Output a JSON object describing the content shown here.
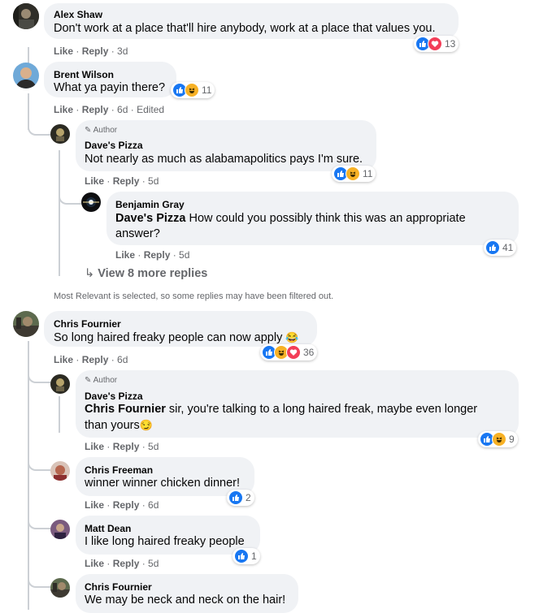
{
  "comments": [
    {
      "name": "Alex Shaw",
      "text": "Don't work at a place that'll hire anybody, work at a place that values you.",
      "reaction_count": "13",
      "like": "Like",
      "reply": "Reply",
      "time": "3d"
    },
    {
      "name": "Brent Wilson",
      "text": "What ya payin there?",
      "reaction_count": "11",
      "like": "Like",
      "reply": "Reply",
      "time": "6d",
      "edited": "Edited"
    },
    {
      "author_badge": "Author",
      "name": "Dave's Pizza",
      "text": "Not nearly as much as alabamapolitics pays I'm sure.",
      "reaction_count": "11",
      "like": "Like",
      "reply": "Reply",
      "time": "5d"
    },
    {
      "name": "Benjamin Gray",
      "mention": "Dave's Pizza",
      "text": " How could you possibly think this was an appropriate answer?",
      "reaction_count": "41",
      "like": "Like",
      "reply": "Reply",
      "time": "5d"
    },
    {
      "name": "Chris Fournier",
      "text": "So long haired freaky people can now apply",
      "emoji": "😂",
      "reaction_count": "36",
      "like": "Like",
      "reply": "Reply",
      "time": "6d"
    },
    {
      "author_badge": "Author",
      "name": "Dave's Pizza",
      "mention": "Chris Fournier",
      "text": " sir, you're talking to a long haired freak, maybe even longer than yours",
      "emoji": "😏",
      "reaction_count": "9",
      "like": "Like",
      "reply": "Reply",
      "time": "5d"
    },
    {
      "name": "Chris Freeman",
      "text": "winner winner chicken dinner!",
      "reaction_count": "2",
      "like": "Like",
      "reply": "Reply",
      "time": "6d"
    },
    {
      "name": "Matt Dean",
      "text": "I like long haired freaky people",
      "reaction_count": "1",
      "like": "Like",
      "reply": "Reply",
      "time": "5d"
    },
    {
      "name": "Chris Fournier",
      "text": "We may be neck and neck on the hair!"
    }
  ],
  "view_more": "View 8 more replies",
  "filter_notice": "Most Relevant is selected, so some replies may have been filtered out.",
  "colors": {
    "like": "#1877f2",
    "love": "#f33e58",
    "haha": "#f7b125",
    "bubble": "#f0f2f5",
    "meta": "#65676b"
  },
  "icons": {
    "like": "thumbs-up-icon",
    "love": "heart-icon",
    "haha": "laughing-icon",
    "author": "pencil-icon",
    "reply_arrow": "reply-arrow-icon"
  }
}
